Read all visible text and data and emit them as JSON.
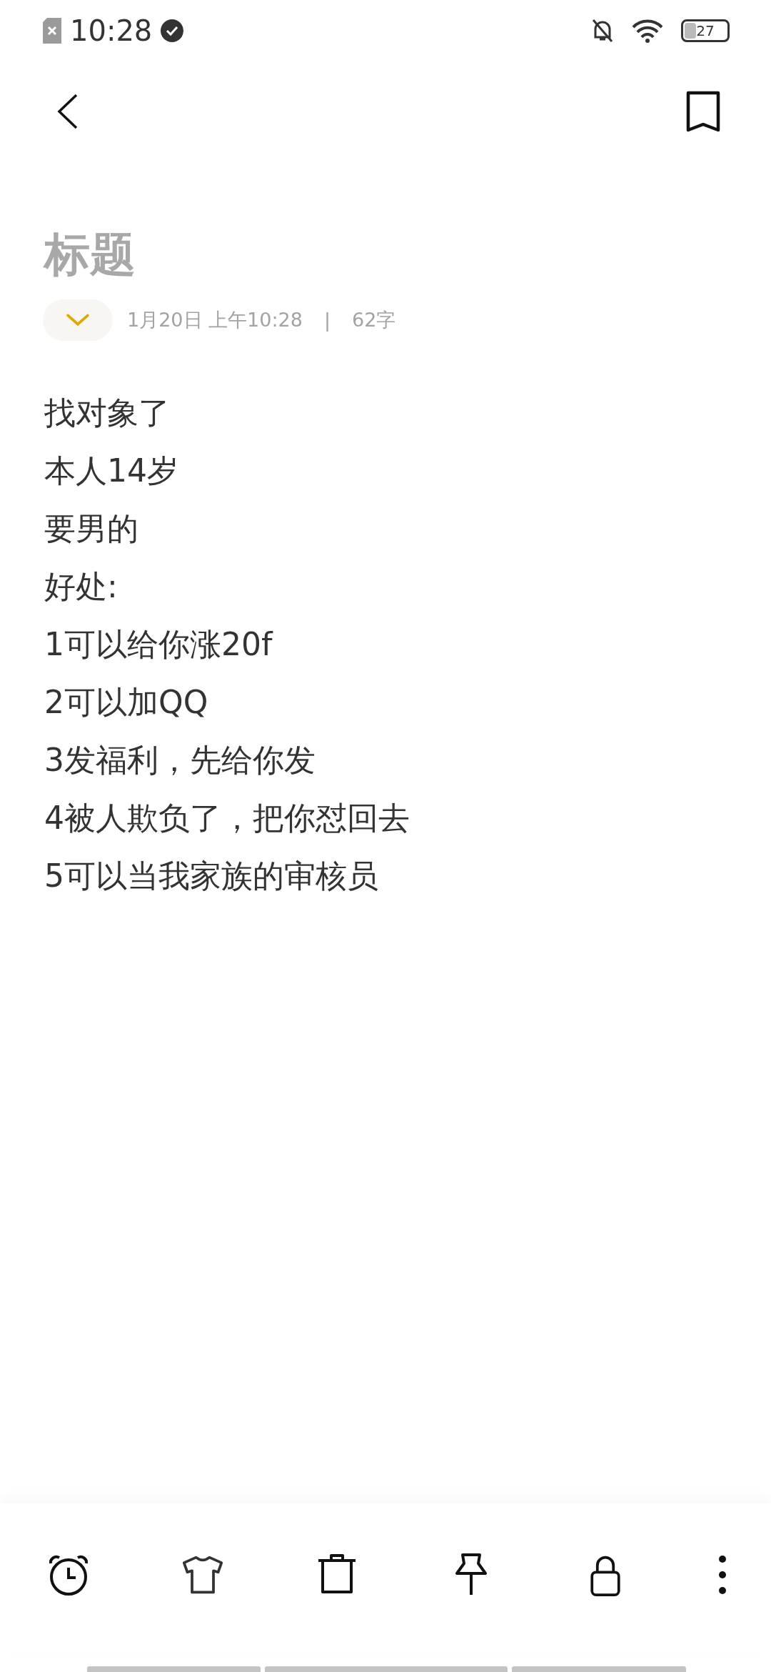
{
  "status_bar": {
    "time": "10:28",
    "battery": "27"
  },
  "title": {
    "placeholder": "标题"
  },
  "meta": {
    "date": "1月20日 上午10:28",
    "separator": "|",
    "count": "62字"
  },
  "body": {
    "lines": [
      "找对象了",
      "本人14岁",
      "要男的",
      "好处:",
      "1可以给你涨20f",
      "2可以加QQ",
      "3发福利，先给你发",
      "4被人欺负了，把你怼回去",
      "5可以当我家族的审核员"
    ]
  },
  "toolbar": [
    {
      "kind": "alarm"
    },
    {
      "kind": "shirt"
    },
    {
      "kind": "trash"
    },
    {
      "kind": "pin"
    },
    {
      "kind": "lock"
    },
    {
      "kind": "more"
    }
  ]
}
